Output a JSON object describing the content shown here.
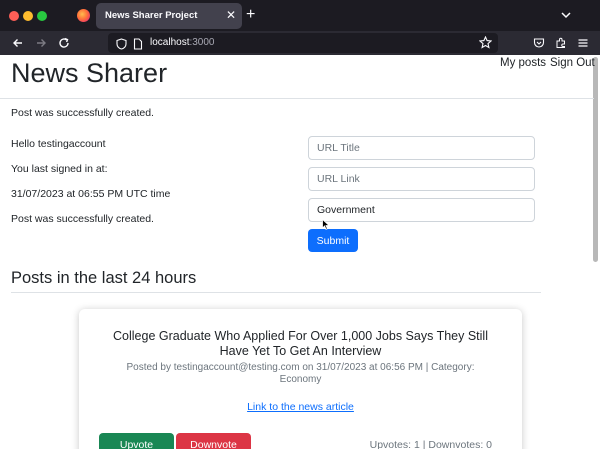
{
  "browser": {
    "tab_title": "News Sharer Project",
    "url_host": "localhost",
    "url_port": ":3000"
  },
  "header": {
    "brand": "News Sharer",
    "links": [
      "My posts",
      "Sign Out"
    ]
  },
  "flash_notice": "Post was successfully created.",
  "sidebar_info": {
    "greeting": "Hello testingaccount",
    "last_signed_label": "You last signed in at:",
    "last_signed_value": "31/07/2023 at 06:55 PM UTC time",
    "notice": "Post was successfully created."
  },
  "form": {
    "url_title_placeholder": "URL Title",
    "url_link_placeholder": "URL Link",
    "category_value": "Government",
    "submit_label": "Submit"
  },
  "posts_section": {
    "title": "Posts in the last 24 hours",
    "posts": [
      {
        "title": "College Graduate Who Applied For Over 1,000 Jobs Says They Still Have Yet To Get An Interview",
        "meta": "Posted by testingaccount@testing.com on 31/07/2023 at 06:56 PM | Category: Economy",
        "link_label": "Link to the news article",
        "upvote_label": "Upvote",
        "downvote_label": "Downvote",
        "vote_counts": "Upvotes: 1 | Downvotes: 0"
      }
    ]
  },
  "colors": {
    "primary": "#0d6efd",
    "success": "#198754",
    "danger": "#dc3545"
  }
}
